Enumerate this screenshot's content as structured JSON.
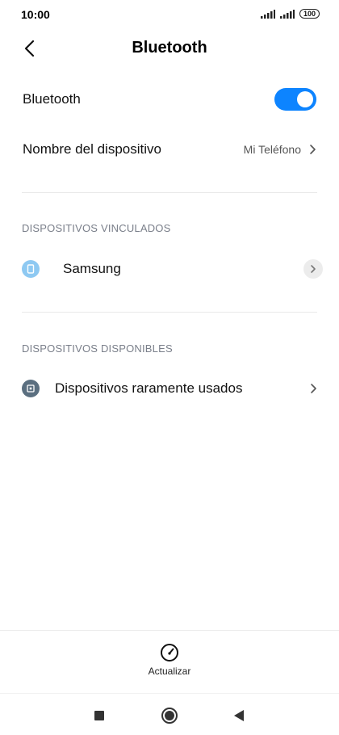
{
  "status_bar": {
    "time": "10:00",
    "battery": "100"
  },
  "header": {
    "title": "Bluetooth"
  },
  "bluetooth_row": {
    "label": "Bluetooth",
    "enabled": true
  },
  "device_name_row": {
    "label": "Nombre del dispositivo",
    "value": "Mi Teléfono"
  },
  "paired": {
    "header": "DISPOSITIVOS VINCULADOS",
    "devices": [
      {
        "name": "Samsung",
        "icon": "phone-icon"
      }
    ]
  },
  "available": {
    "header": "DISPOSITIVOS DISPONIBLES",
    "items": [
      {
        "name": "Dispositivos raramente usados",
        "icon": "device-box-icon"
      }
    ]
  },
  "bottom_action": {
    "label": "Actualizar",
    "icon": "refresh-gauge-icon"
  },
  "colors": {
    "accent": "#0d84ff",
    "paired_icon": "#8ec9f2",
    "available_icon": "#5b6f80"
  }
}
